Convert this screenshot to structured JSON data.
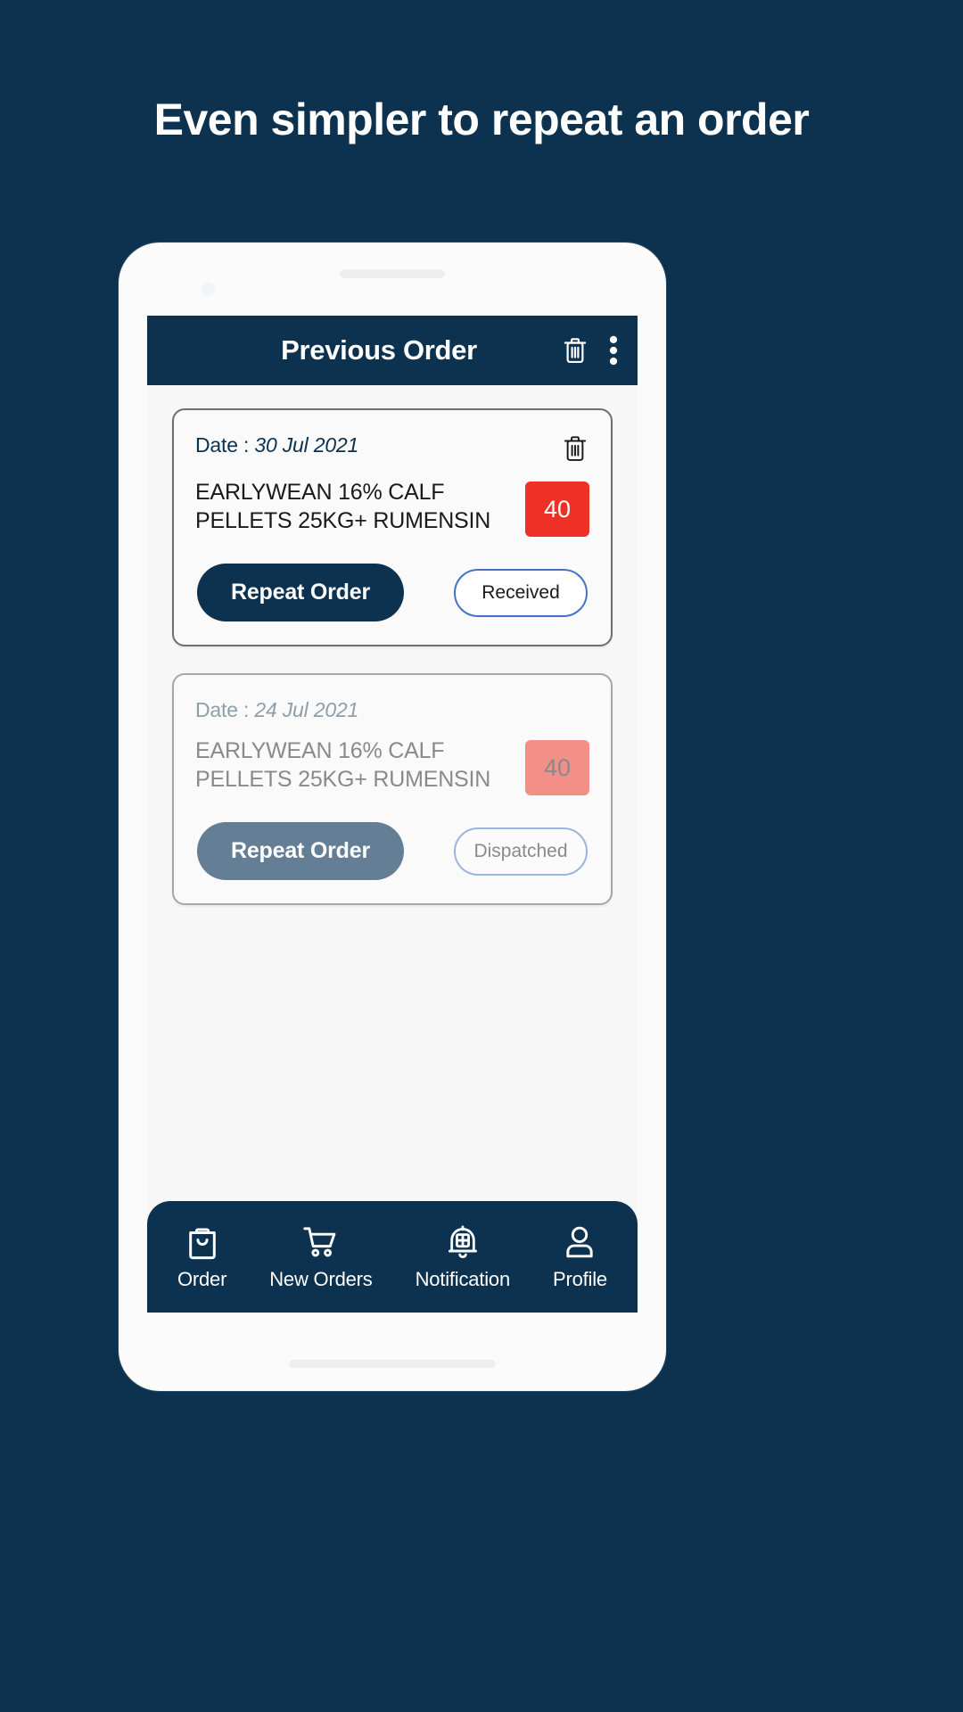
{
  "headline": "Even simpler to repeat an order",
  "colors": {
    "background": "#0d3250",
    "brand_navy": "#0d3250",
    "accent_red": "#ee3124",
    "accent_red_muted": "#f29088",
    "pill_border_blue": "#4472c4",
    "muted_button": "#637e95",
    "screen_bg": "#f7f7f7"
  },
  "appbar": {
    "title": "Previous Order",
    "delete_icon": "trash-icon",
    "menu_icon": "kebab-menu-icon"
  },
  "orders": [
    {
      "date_label": "Date :",
      "date_value": "30 Jul 2021",
      "product": "EARLYWEAN 16% CALF PELLETS 25KG+ RUMENSIN",
      "quantity": "40",
      "repeat_label": "Repeat Order",
      "status": "Received",
      "state": "active",
      "trash_icon": "trash-icon"
    },
    {
      "date_label": "Date :",
      "date_value": "24 Jul 2021",
      "product": "EARLYWEAN 16% CALF PELLETS 25KG+ RUMENSIN",
      "quantity": "40",
      "repeat_label": "Repeat Order",
      "status": "Dispatched",
      "state": "muted",
      "trash_icon": ""
    }
  ],
  "bottom_nav": [
    {
      "label": "Order",
      "icon": "shopping-bag-icon"
    },
    {
      "label": "New Orders",
      "icon": "shopping-cart-icon"
    },
    {
      "label": "Notification",
      "icon": "bell-plus-icon"
    },
    {
      "label": "Profile",
      "icon": "user-icon"
    }
  ]
}
